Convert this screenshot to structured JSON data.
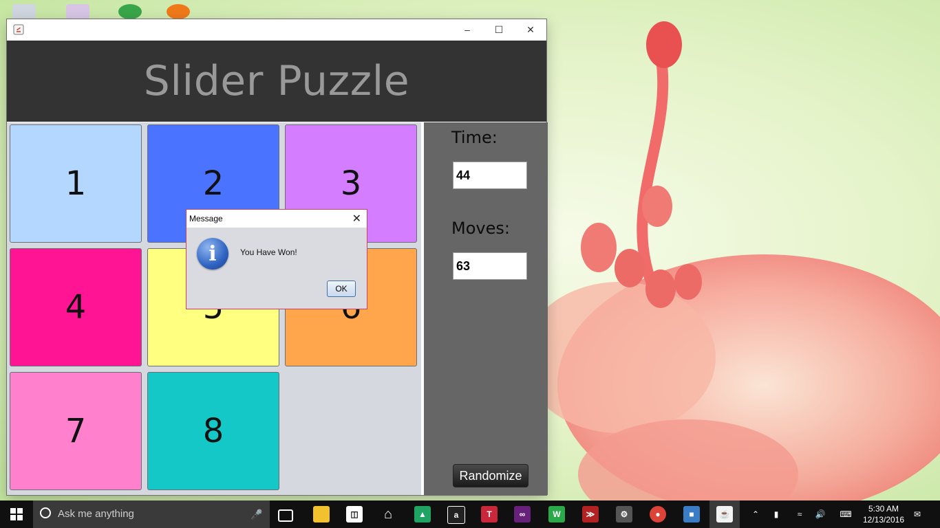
{
  "window": {
    "header_title": "Slider Puzzle",
    "controls": [
      "minimize",
      "maximize",
      "close"
    ]
  },
  "tiles": [
    {
      "label": "1",
      "color": "#b3d7ff"
    },
    {
      "label": "2",
      "color": "#4a74ff"
    },
    {
      "label": "3",
      "color": "#d47eff"
    },
    {
      "label": "4",
      "color": "#ff1493"
    },
    {
      "label": "5",
      "color": "#ffff80"
    },
    {
      "label": "6",
      "color": "#ffa64d"
    },
    {
      "label": "7",
      "color": "#ff80cc"
    },
    {
      "label": "8",
      "color": "#14c8c8"
    }
  ],
  "side_panel": {
    "time_label": "Time:",
    "time_value": "44",
    "moves_label": "Moves:",
    "moves_value": "63",
    "randomize_label": "Randomize"
  },
  "dialog": {
    "title": "Message",
    "message": "You Have Won!",
    "ok_label": "OK"
  },
  "taskbar": {
    "search_placeholder": "Ask me anything",
    "time": "5:30 AM",
    "date": "12/13/2016",
    "pinned": [
      "task-view",
      "file-explorer",
      "store",
      "home",
      "google-drive",
      "amazon",
      "t-app",
      "visual-studio",
      "webstorm",
      "terminal",
      "gadget",
      "chrome",
      "virtualbox",
      "java"
    ]
  },
  "colors": {
    "header_bg": "#333333",
    "header_text": "#999999",
    "side_bg": "#666666",
    "board_bg": "#d5d8de",
    "dialog_border": "#d0415f",
    "taskbar_bg": "#101010"
  }
}
